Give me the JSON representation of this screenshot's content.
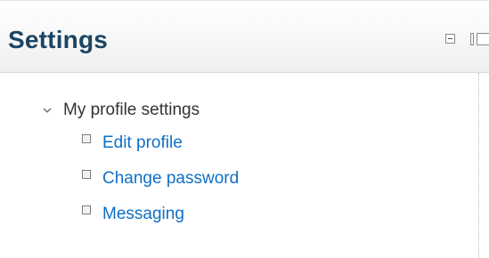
{
  "block": {
    "title": "Settings"
  },
  "header_controls": {
    "collapse_icon": "minus-icon",
    "dock_icon": "dock-icon"
  },
  "tree": {
    "branch": {
      "label": "My profile settings",
      "icon": "chevron-down-icon",
      "expanded": true
    },
    "items": [
      {
        "label": "Edit profile",
        "icon": "bullet-icon"
      },
      {
        "label": "Change password",
        "icon": "bullet-icon"
      },
      {
        "label": "Messaging",
        "icon": "bullet-icon"
      }
    ]
  },
  "colors": {
    "title": "#1c4563",
    "link": "#0f6fc5",
    "text": "#333333"
  }
}
